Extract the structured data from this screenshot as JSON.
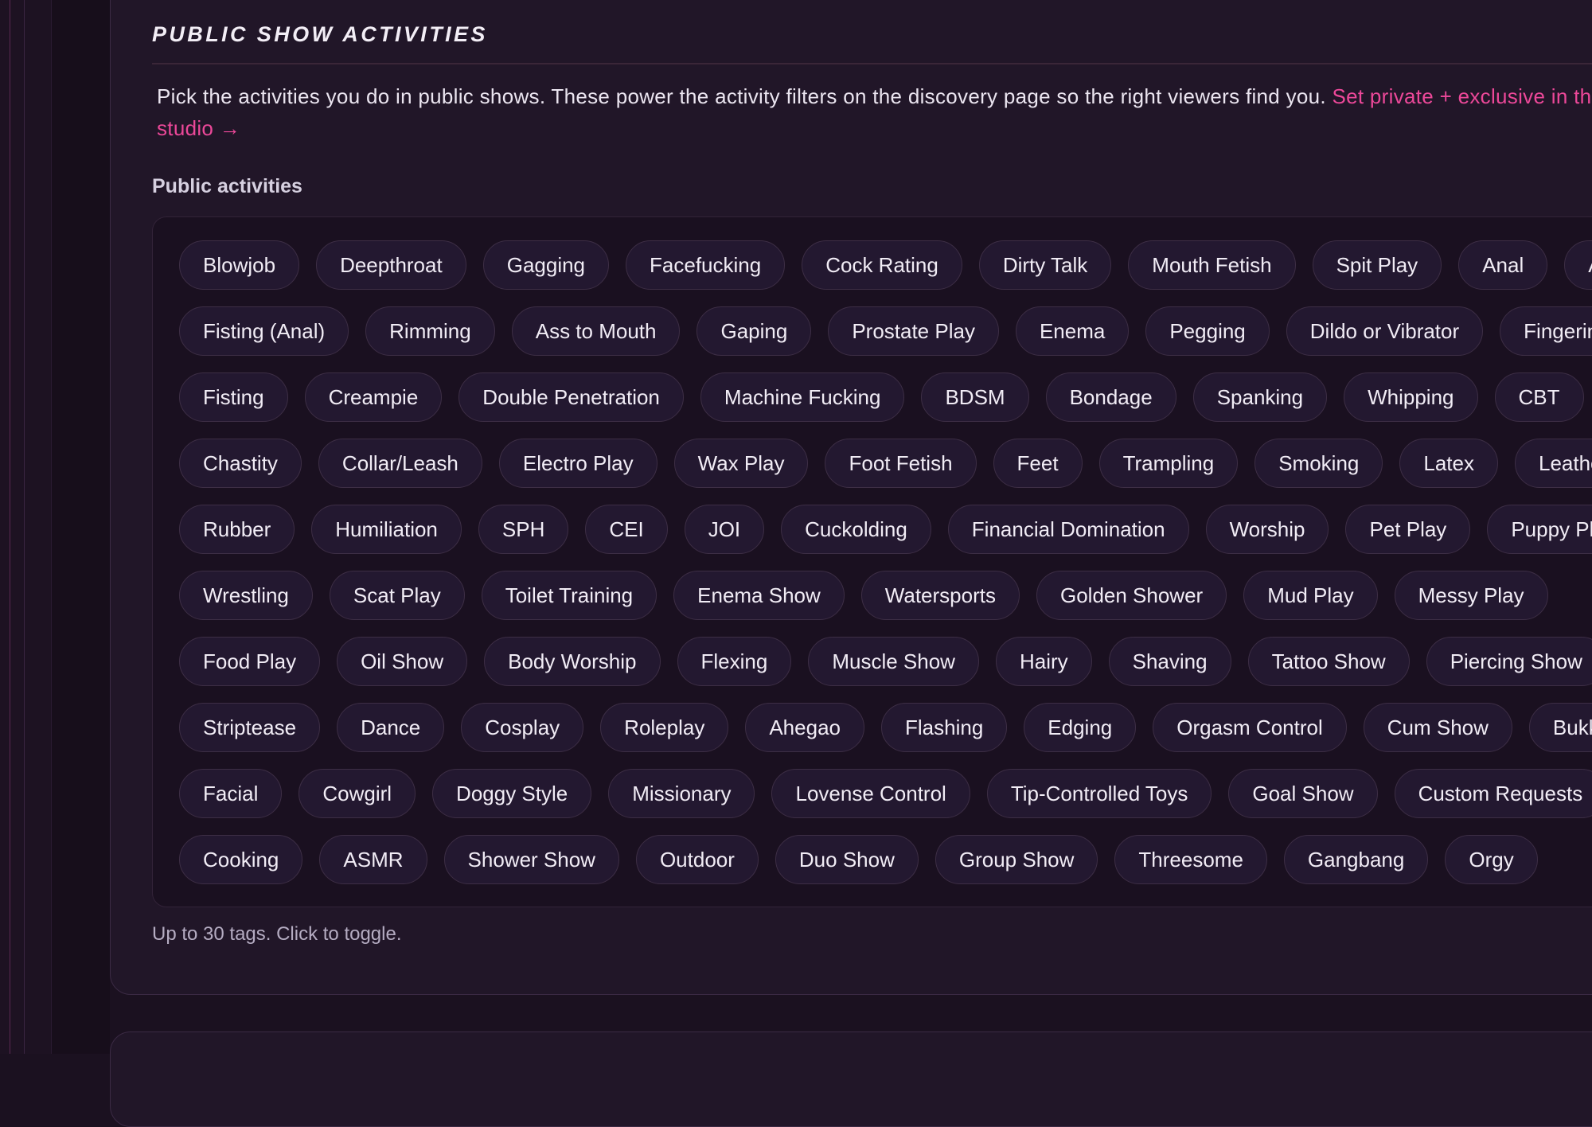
{
  "section": {
    "title": "PUBLIC SHOW ACTIVITIES",
    "description": "Pick the activities you do in public shows. These power the activity filters on the discovery page so the right viewers find you.",
    "link_text": "Set private + exclusive in the studio →"
  },
  "field": {
    "label": "Public activities",
    "helper": "Up to 30 tags. Click to toggle."
  },
  "colors": {
    "accent": "#ec4899",
    "background": "#1b1120",
    "card": "#211628",
    "chip": "#231830"
  },
  "tag_rows": [
    [
      "Blowjob",
      "Deepthroat",
      "Gagging",
      "Facefucking",
      "Cock Rating",
      "Dirty Talk",
      "Mouth Fetish",
      "Spit Play",
      "Anal",
      "A"
    ],
    [
      "Fisting (Anal)",
      "Rimming",
      "Ass to Mouth",
      "Gaping",
      "Prostate Play",
      "Enema",
      "Pegging",
      "Dildo or Vibrator",
      "Fingerin"
    ],
    [
      "Fisting",
      "Creampie",
      "Double Penetration",
      "Machine Fucking",
      "BDSM",
      "Bondage",
      "Spanking",
      "Whipping",
      "CBT"
    ],
    [
      "Chastity",
      "Collar/Leash",
      "Electro Play",
      "Wax Play",
      "Foot Fetish",
      "Feet",
      "Trampling",
      "Smoking",
      "Latex",
      "Leathe"
    ],
    [
      "Rubber",
      "Humiliation",
      "SPH",
      "CEI",
      "JOI",
      "Cuckolding",
      "Financial Domination",
      "Worship",
      "Pet Play",
      "Puppy Pla"
    ],
    [
      "Wrestling",
      "Scat Play",
      "Toilet Training",
      "Enema Show",
      "Watersports",
      "Golden Shower",
      "Mud Play",
      "Messy Play"
    ],
    [
      "Food Play",
      "Oil Show",
      "Body Worship",
      "Flexing",
      "Muscle Show",
      "Hairy",
      "Shaving",
      "Tattoo Show",
      "Piercing Show"
    ],
    [
      "Striptease",
      "Dance",
      "Cosplay",
      "Roleplay",
      "Ahegao",
      "Flashing",
      "Edging",
      "Orgasm Control",
      "Cum Show",
      "Bukk"
    ],
    [
      "Facial",
      "Cowgirl",
      "Doggy Style",
      "Missionary",
      "Lovense Control",
      "Tip-Controlled Toys",
      "Goal Show",
      "Custom Requests"
    ],
    [
      "Cooking",
      "ASMR",
      "Shower Show",
      "Outdoor",
      "Duo Show",
      "Group Show",
      "Threesome",
      "Gangbang",
      "Orgy"
    ]
  ]
}
